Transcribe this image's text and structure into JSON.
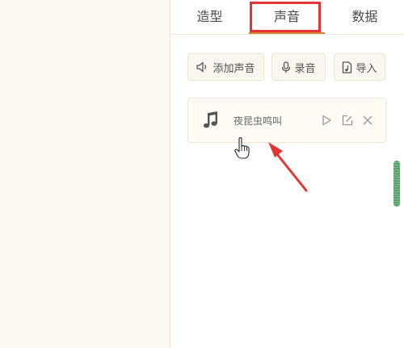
{
  "tabs": [
    {
      "label": "造型",
      "active": false
    },
    {
      "label": "声音",
      "active": true
    },
    {
      "label": "数据",
      "active": false
    }
  ],
  "toolbar": {
    "add_sound_label": "添加声音",
    "record_label": "录音",
    "import_label": "导入"
  },
  "sound_list": [
    {
      "name": "夜昆虫鸣叫",
      "icon": "music-note-icon"
    }
  ],
  "colors": {
    "stage_bg": "#fdf8f0",
    "panel_bg": "#ffffff",
    "active_underline": "#d9823b",
    "highlight_red": "#e53434",
    "scrollbar_green": "#6cb67d"
  }
}
